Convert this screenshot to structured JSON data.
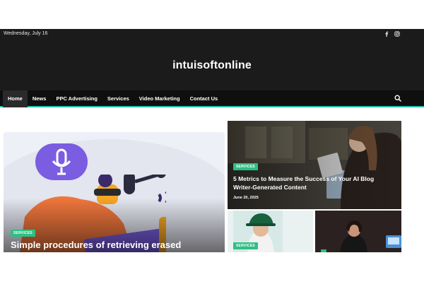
{
  "topbar": {
    "date": "Wednesday, July 16",
    "social": [
      "facebook-icon",
      "instagram-icon"
    ]
  },
  "site": {
    "title": "intuisoftonline"
  },
  "nav": {
    "items": [
      {
        "label": "Home",
        "active": true
      },
      {
        "label": "News"
      },
      {
        "label": "PPC Advertising"
      },
      {
        "label": "Services"
      },
      {
        "label": "Video Marketing"
      },
      {
        "label": "Contact Us"
      }
    ],
    "search_icon": "search-icon",
    "accent": "#27c2ad"
  },
  "featured": {
    "main": {
      "category": "SERVICES",
      "title": "Simple procedures of retrieving erased"
    },
    "side_top": {
      "category": "SERVICES",
      "title": "5 Metrics to Measure the Success of Your AI Blog Writer-Generated Content",
      "date": "June 20, 2025"
    },
    "side_bottom_left": {
      "category": "SERVICES"
    },
    "side_bottom_right": {
      "category": ""
    }
  },
  "colors": {
    "badge": "#2fbf84",
    "dark": "#1b1b1b"
  }
}
